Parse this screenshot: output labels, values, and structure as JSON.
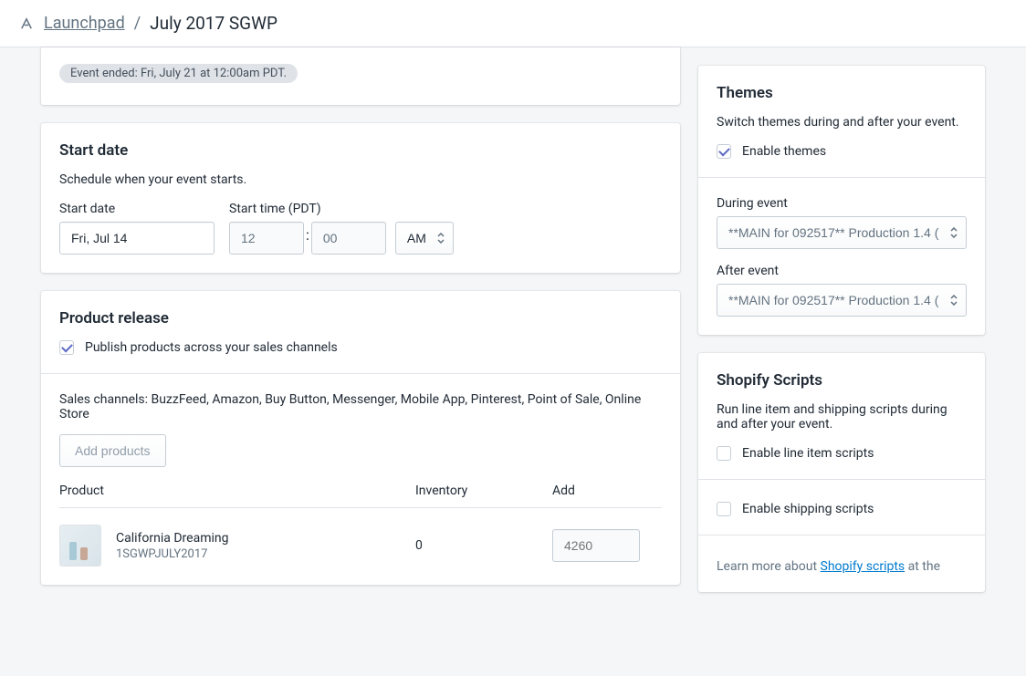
{
  "breadcrumb": {
    "app": "Launchpad",
    "separator": "/",
    "title": "July 2017 SGWP"
  },
  "status": {
    "text": "Event ended: Fri, July 21 at 12:00am PDT."
  },
  "start_date": {
    "title": "Start date",
    "description": "Schedule when your event starts.",
    "date_label": "Start date",
    "date_value": "Fri, Jul 14",
    "time_label": "Start time (PDT)",
    "hour": "12",
    "minute": "00",
    "ampm": "AM"
  },
  "product_release": {
    "title": "Product release",
    "publish_label": "Publish products across your sales channels",
    "publish_checked": true,
    "channels_text": "Sales channels: BuzzFeed, Amazon, Buy Button, Messenger, Mobile App, Pinterest, Point of Sale, Online Store",
    "add_products_button": "Add products",
    "table": {
      "col_product": "Product",
      "col_inventory": "Inventory",
      "col_add": "Add",
      "rows": [
        {
          "name": "California Dreaming",
          "sku": "1SGWPJULY2017",
          "inventory": "0",
          "add_placeholder": "4260"
        }
      ]
    }
  },
  "themes": {
    "title": "Themes",
    "description": "Switch themes during and after your event.",
    "enable_label": "Enable themes",
    "enable_checked": true,
    "during_label": "During event",
    "during_value": "**MAIN for 092517** Production 1.4 (",
    "after_label": "After event",
    "after_value": "**MAIN for 092517** Production 1.4 ("
  },
  "scripts": {
    "title": "Shopify Scripts",
    "description": "Run line item and shipping scripts during and after your event.",
    "line_item_label": "Enable line item scripts",
    "line_item_checked": false,
    "shipping_label": "Enable shipping scripts",
    "shipping_checked": false,
    "learn_prefix": "Learn more about ",
    "learn_link": "Shopify scripts",
    "learn_suffix": " at the"
  }
}
